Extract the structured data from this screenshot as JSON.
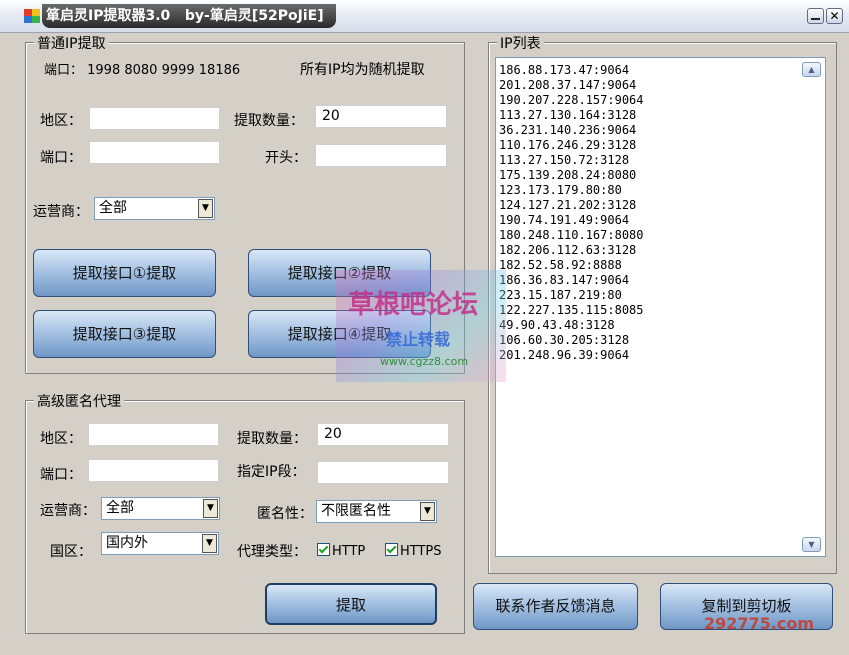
{
  "window": {
    "title_cn": "箪启灵IP提取器3.0",
    "title_by": "by-箪启灵[52PoJiE]"
  },
  "normal": {
    "group_title": "普通IP提取",
    "ports_line": "端口：  1998 8080  9999 18186",
    "random_note": "所有IP均为随机提取",
    "region_label": "地区：",
    "region_value": "",
    "count_label": "提取数量：",
    "count_value": "20",
    "port_label": "端口：",
    "port_value": "",
    "prefix_label": "开头：",
    "prefix_value": "",
    "isp_label": "运营商：",
    "isp_value": "全部",
    "btn1": "提取接口①提取",
    "btn2": "提取接口②提取",
    "btn3": "提取接口③提取",
    "btn4": "提取接口④提取"
  },
  "advanced": {
    "group_title": "高级匿名代理",
    "region_label": "地区：",
    "region_value": "",
    "count_label": "提取数量：",
    "count_value": "20",
    "port_label": "端口：",
    "port_value": "",
    "segment_label": "指定IP段：",
    "segment_value": "",
    "isp_label": "运营商：",
    "isp_value": "全部",
    "anon_label": "匿名性：",
    "anon_value": "不限匿名性",
    "country_label": "国区：",
    "country_value": "国内外",
    "proxy_label": "代理类型：",
    "http_label": "HTTP",
    "https_label": "HTTPS",
    "http_checked": true,
    "https_checked": true,
    "extract_btn": "提取"
  },
  "iplist": {
    "group_title": "IP列表",
    "items": [
      "186.88.173.47:9064",
      "201.208.37.147:9064",
      "190.207.228.157:9064",
      "113.27.130.164:3128",
      "36.231.140.236:9064",
      "110.176.246.29:3128",
      "113.27.150.72:3128",
      "175.139.208.24:8080",
      "123.173.179.80:80",
      "124.127.21.202:3128",
      "190.74.191.49:9064",
      "180.248.110.167:8080",
      "182.206.112.63:3128",
      "182.52.58.92:8888",
      "186.36.83.147:9064",
      "223.15.187.219:80",
      "122.227.135.115:8085",
      "49.90.43.48:3128",
      "106.60.30.205:3128",
      "201.248.96.39:9064"
    ]
  },
  "footer": {
    "contact_btn": "联系作者反馈消息",
    "copy_btn": "复制到剪切板"
  },
  "watermarks": {
    "forum": "草根吧论坛",
    "no_repost": "禁止转载",
    "url": "www.cgzz8.com",
    "site_num": "292775.com"
  },
  "colors": {
    "button_accent": "#6f97c6",
    "window_bg": "#d4d0c8"
  }
}
